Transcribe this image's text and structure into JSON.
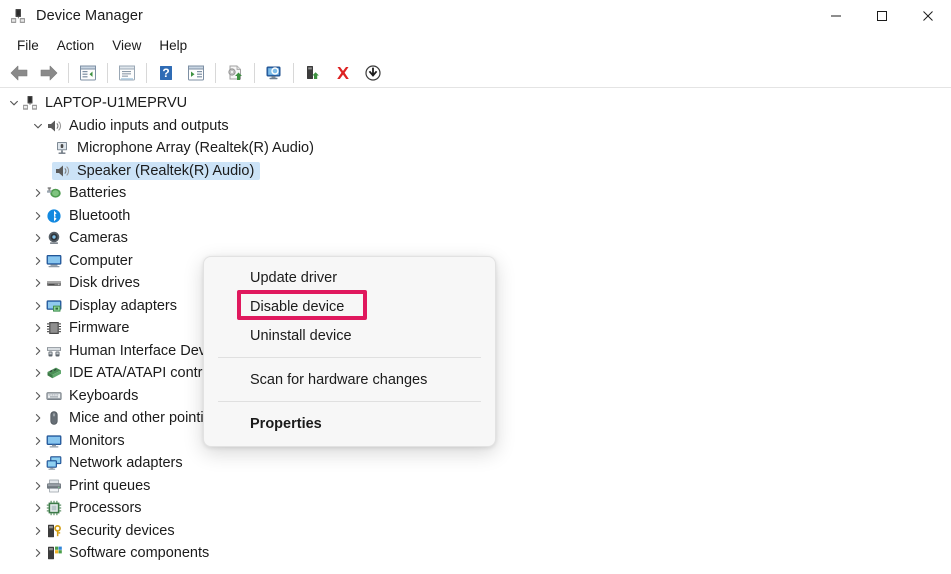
{
  "window": {
    "title": "Device Manager",
    "icon": "device-manager-icon",
    "controls": {
      "minimize": "—",
      "maximize": "☐",
      "close": "✕"
    }
  },
  "menubar": {
    "items": [
      {
        "label": "File"
      },
      {
        "label": "Action"
      },
      {
        "label": "View"
      },
      {
        "label": "Help"
      }
    ]
  },
  "toolbar": {
    "buttons": [
      {
        "name": "back-button",
        "icon": "back-arrow-icon"
      },
      {
        "name": "forward-button",
        "icon": "forward-arrow-icon"
      },
      {
        "sep": true
      },
      {
        "name": "show-hide-console-tree-button",
        "icon": "console-tree-icon"
      },
      {
        "sep": true
      },
      {
        "name": "properties-button",
        "icon": "properties-window-icon"
      },
      {
        "sep": true
      },
      {
        "name": "help-button",
        "icon": "help-question-icon"
      },
      {
        "name": "action-menu-button",
        "icon": "action-play-icon"
      },
      {
        "sep": true
      },
      {
        "name": "update-driver-button",
        "icon": "update-driver-icon"
      },
      {
        "sep": true
      },
      {
        "name": "scan-hardware-changes-button",
        "icon": "scan-monitor-icon"
      },
      {
        "sep": true
      },
      {
        "name": "enable-device-button",
        "icon": "enable-device-icon"
      },
      {
        "name": "uninstall-device-button",
        "icon": "red-x-icon"
      },
      {
        "name": "disable-device-button",
        "icon": "disable-down-arrow-icon"
      }
    ]
  },
  "tree": {
    "items": [
      {
        "label": "LAPTOP-U1MEPRVU",
        "level": 0,
        "state": "expanded",
        "icon": "computer-root-icon",
        "selected": false
      },
      {
        "label": "Audio inputs and outputs",
        "level": 1,
        "state": "expanded",
        "icon": "speaker-icon",
        "selected": false
      },
      {
        "label": "Microphone Array (Realtek(R) Audio)",
        "level": 2,
        "state": "leaf",
        "icon": "microphone-icon",
        "selected": false
      },
      {
        "label": "Speaker (Realtek(R) Audio)",
        "level": 2,
        "state": "leaf",
        "icon": "speaker-icon",
        "selected": true
      },
      {
        "label": "Batteries",
        "level": 1,
        "state": "collapsed",
        "icon": "battery-icon",
        "selected": false
      },
      {
        "label": "Bluetooth",
        "level": 1,
        "state": "collapsed",
        "icon": "bluetooth-icon",
        "selected": false
      },
      {
        "label": "Cameras",
        "level": 1,
        "state": "collapsed",
        "icon": "camera-icon",
        "selected": false
      },
      {
        "label": "Computer",
        "level": 1,
        "state": "collapsed",
        "icon": "computer-icon",
        "selected": false
      },
      {
        "label": "Disk drives",
        "level": 1,
        "state": "collapsed",
        "icon": "disk-drive-icon",
        "selected": false
      },
      {
        "label": "Display adapters",
        "level": 1,
        "state": "collapsed",
        "icon": "display-adapter-icon",
        "selected": false
      },
      {
        "label": "Firmware",
        "level": 1,
        "state": "collapsed",
        "icon": "firmware-chip-icon",
        "selected": false
      },
      {
        "label": "Human Interface Devices",
        "level": 1,
        "state": "collapsed",
        "icon": "hid-icon",
        "selected": false
      },
      {
        "label": "IDE ATA/ATAPI controllers",
        "level": 1,
        "state": "collapsed",
        "icon": "ide-controller-icon",
        "selected": false
      },
      {
        "label": "Keyboards",
        "level": 1,
        "state": "collapsed",
        "icon": "keyboard-icon",
        "selected": false
      },
      {
        "label": "Mice and other pointing devices",
        "level": 1,
        "state": "collapsed",
        "icon": "mouse-icon",
        "selected": false
      },
      {
        "label": "Monitors",
        "level": 1,
        "state": "collapsed",
        "icon": "monitor-icon",
        "selected": false
      },
      {
        "label": "Network adapters",
        "level": 1,
        "state": "collapsed",
        "icon": "network-adapter-icon",
        "selected": false
      },
      {
        "label": "Print queues",
        "level": 1,
        "state": "collapsed",
        "icon": "printer-icon",
        "selected": false
      },
      {
        "label": "Processors",
        "level": 1,
        "state": "collapsed",
        "icon": "processor-icon",
        "selected": false
      },
      {
        "label": "Security devices",
        "level": 1,
        "state": "collapsed",
        "icon": "security-key-icon",
        "selected": false
      },
      {
        "label": "Software components",
        "level": 1,
        "state": "collapsed",
        "icon": "software-component-icon",
        "selected": false
      }
    ]
  },
  "context_menu": {
    "items": [
      {
        "label": "Update driver",
        "bold": false,
        "highlighted": false
      },
      {
        "label": "Disable device",
        "bold": false,
        "highlighted": true
      },
      {
        "label": "Uninstall device",
        "bold": false,
        "highlighted": false
      },
      {
        "separator": true
      },
      {
        "label": "Scan for hardware changes",
        "bold": false,
        "highlighted": false
      },
      {
        "separator": true
      },
      {
        "label": "Properties",
        "bold": true,
        "highlighted": false
      }
    ]
  },
  "colors": {
    "highlight_box": "#e0195e",
    "selection": "#cce3f7",
    "menu_bg": "#f7f7f7",
    "text": "#1b1b1b"
  }
}
